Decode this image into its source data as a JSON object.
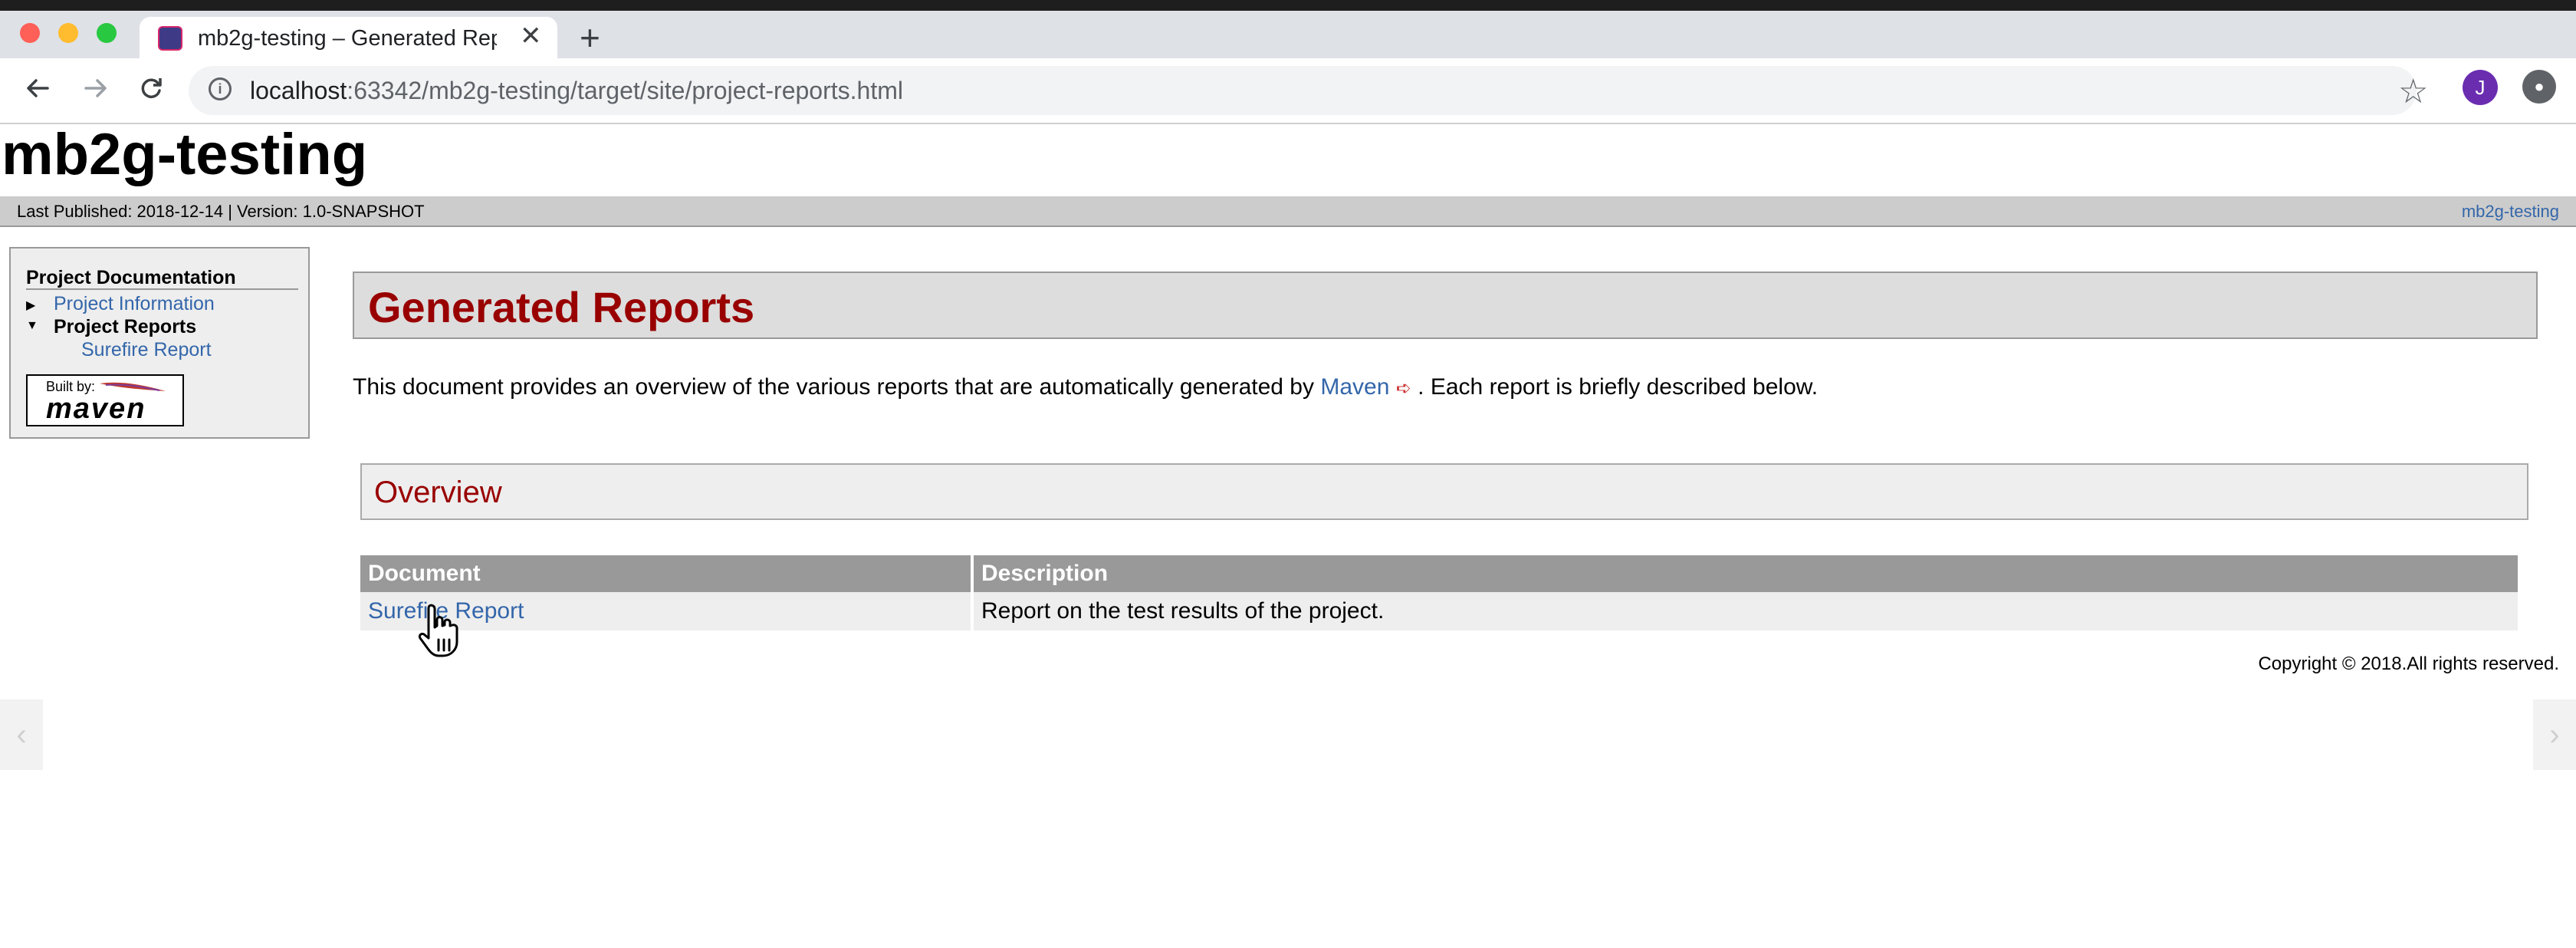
{
  "browser": {
    "tab_title": "mb2g-testing – Generated Rep",
    "close_glyph": "✕",
    "new_tab_glyph": "+",
    "url_host": "localhost",
    "url_path": ":63342/mb2g-testing/target/site/project-reports.html",
    "profile_initial": "J",
    "icons": [
      "back-icon",
      "forward-icon",
      "reload-icon",
      "info-icon",
      "star-icon",
      "profile-avatar",
      "extension-icon"
    ]
  },
  "site": {
    "title": "mb2g-testing",
    "published": "Last Published: 2018-12-14  | Version: 1.0-SNAPSHOT",
    "breadcrumb_right": "mb2g-testing"
  },
  "sidebar": {
    "heading": "Project Documentation",
    "items": [
      {
        "label": "Project Information",
        "expanded": false
      },
      {
        "label": "Project Reports",
        "expanded": true
      },
      {
        "label": "Surefire Report",
        "child": true
      }
    ],
    "built_by_label": "Built by:",
    "built_by_brand": "maven"
  },
  "main": {
    "heading": "Generated Reports",
    "intro_before": "This document provides an overview of the various reports that are automatically generated by ",
    "intro_link": "Maven",
    "intro_after": " . Each report is briefly described below.",
    "overview_heading": "Overview",
    "table": {
      "headers": [
        "Document",
        "Description"
      ],
      "rows": [
        [
          "Surefire Report",
          "Report on the test results of the project."
        ]
      ]
    }
  },
  "footer": {
    "copyright": "Copyright © 2018.All rights reserved."
  },
  "colors": {
    "heading_red": "#990000",
    "link_blue": "#3366aa",
    "table_header": "#999999"
  }
}
